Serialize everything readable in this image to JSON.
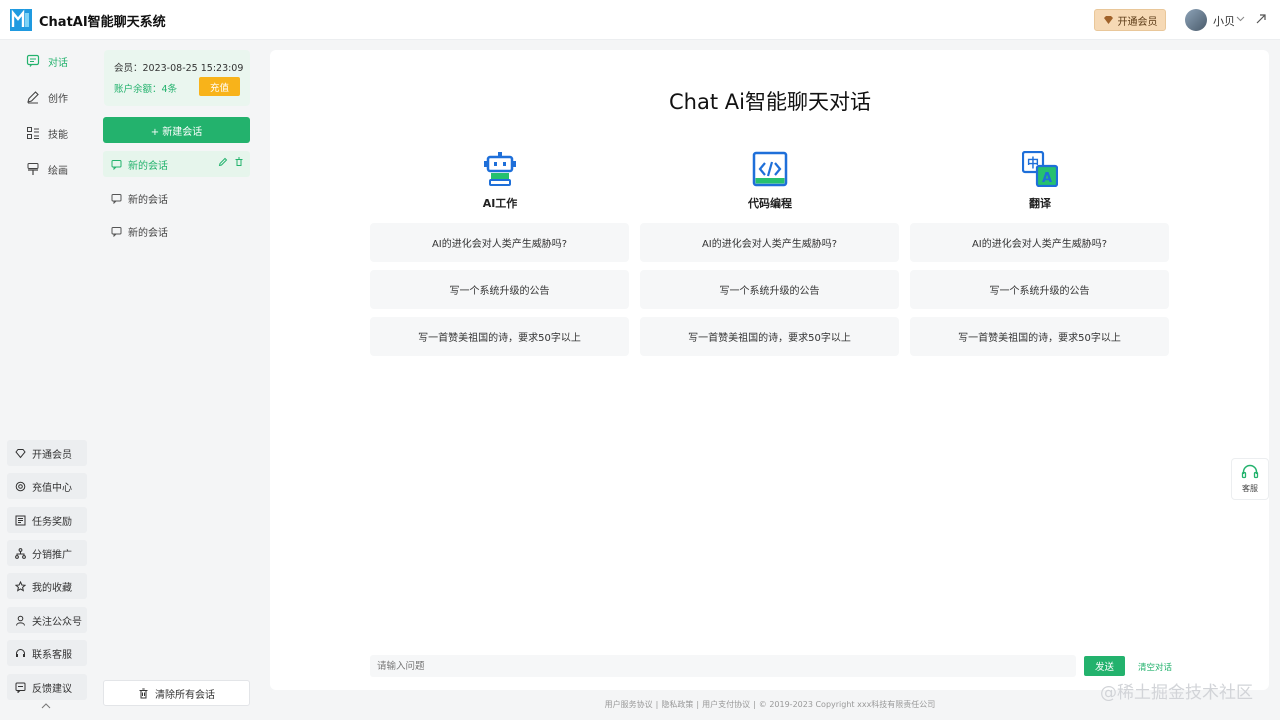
{
  "header": {
    "app_title": "ChatAI智能聊天系统",
    "vip_button": "开通会员",
    "user_name": "小贝"
  },
  "nav": {
    "items": [
      {
        "label": "对话",
        "icon": "chat-icon",
        "active": true
      },
      {
        "label": "创作",
        "icon": "pencil-icon",
        "active": false
      },
      {
        "label": "技能",
        "icon": "list-icon",
        "active": false
      },
      {
        "label": "绘画",
        "icon": "brush-icon",
        "active": false
      }
    ],
    "bottom_items": [
      {
        "label": "开通会员",
        "icon": "diamond-icon"
      },
      {
        "label": "充值中心",
        "icon": "coin-icon"
      },
      {
        "label": "任务奖励",
        "icon": "task-icon"
      },
      {
        "label": "分销推广",
        "icon": "network-icon"
      },
      {
        "label": "我的收藏",
        "icon": "star-icon"
      },
      {
        "label": "关注公众号",
        "icon": "user-icon"
      },
      {
        "label": "联系客服",
        "icon": "headset-icon"
      },
      {
        "label": "反馈建议",
        "icon": "feedback-icon"
      }
    ]
  },
  "member": {
    "expiry": "会员：2023-08-25 15:23:09",
    "balance": "账户余额：4条",
    "recharge_label": "充值"
  },
  "sessions": {
    "new_chat_label": "+ 新建会话",
    "items": [
      {
        "label": "新的会话",
        "active": true
      },
      {
        "label": "新的会话",
        "active": false
      },
      {
        "label": "新的会话",
        "active": false
      }
    ],
    "clear_all_label": "清除所有会话"
  },
  "main": {
    "title": "Chat Ai智能聊天对话",
    "categories": [
      {
        "label": "AI工作",
        "icon": "robot-icon",
        "prompts": [
          "AI的进化会对人类产生威胁吗?",
          "写一个系统升级的公告",
          "写一首赞美祖国的诗，要求50字以上"
        ]
      },
      {
        "label": "代码编程",
        "icon": "code-icon",
        "prompts": [
          "AI的进化会对人类产生威胁吗?",
          "写一个系统升级的公告",
          "写一首赞美祖国的诗，要求50字以上"
        ]
      },
      {
        "label": "翻译",
        "icon": "translate-icon",
        "prompts": [
          "AI的进化会对人类产生威胁吗?",
          "写一个系统升级的公告",
          "写一首赞美祖国的诗，要求50字以上"
        ]
      }
    ],
    "input_placeholder": "请输入问题",
    "send_label": "发送",
    "clear_conv_label": "清空对话"
  },
  "support": {
    "label": "客服"
  },
  "footer": {
    "links": [
      "用户服务协议",
      "隐私政策",
      "用户支付协议"
    ],
    "copyright": "© 2019-2023 Copyright xxx科技有限责任公司"
  },
  "watermark": "@稀土掘金技术社区",
  "colors": {
    "accent": "#23b26d",
    "recharge": "#f8b31a",
    "vip_bg": "#f6d9b5",
    "icon_blue": "#1e6fd9"
  }
}
